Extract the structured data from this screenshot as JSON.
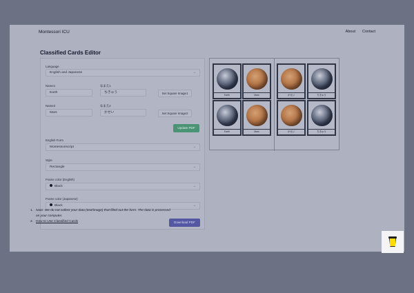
{
  "nav": {
    "brand": "Montessori ICU",
    "links": [
      "About",
      "Contact"
    ]
  },
  "page_title": "Classified Cards Editor",
  "form": {
    "language": {
      "label": "Language",
      "value": "English and Japanese"
    },
    "name1": {
      "label": "Name1",
      "value": "Earth",
      "ja_label": "なまえ1",
      "ja_value": "ちきゅう",
      "button": "Set Square Image1"
    },
    "name2": {
      "label": "Name2",
      "value": "Mars",
      "ja_label": "なまえ2",
      "ja_value": "かせい",
      "button": "Set Square Image2"
    },
    "update_button": "Update PDF",
    "english_form": {
      "label": "English Form",
      "value": "Montessoriscript"
    },
    "style": {
      "label": "Style",
      "value": "Rectangle"
    },
    "frame_en": {
      "label": "Frame color (English)",
      "value": "Black"
    },
    "frame_ja": {
      "label": "Frame color (Japanese)",
      "value": "Black"
    },
    "download_button": "Download PDF"
  },
  "notes": {
    "n1_num": "1.",
    "n1_line1": "Note: We do not collect your data (text/image) that filled out the form. The data is processed",
    "n1_line2": "on your computer.",
    "n2_num": "2.",
    "n2_link": "How to Use Classified Cards"
  },
  "preview": {
    "left_cards": [
      "Earth",
      "Mars",
      "Earth",
      "Mars"
    ],
    "right_cards": [
      "かせい",
      "ちきゅう",
      "かせい",
      "ちきゅう"
    ]
  },
  "colors": {
    "green_button": "#4a9476",
    "indigo_button": "#5457a4",
    "overlay": "#6c7283"
  },
  "icons": {
    "support": "coffee-cup-icon",
    "chevron": "chevron-down-icon",
    "frame_color": "black-dot-icon"
  }
}
